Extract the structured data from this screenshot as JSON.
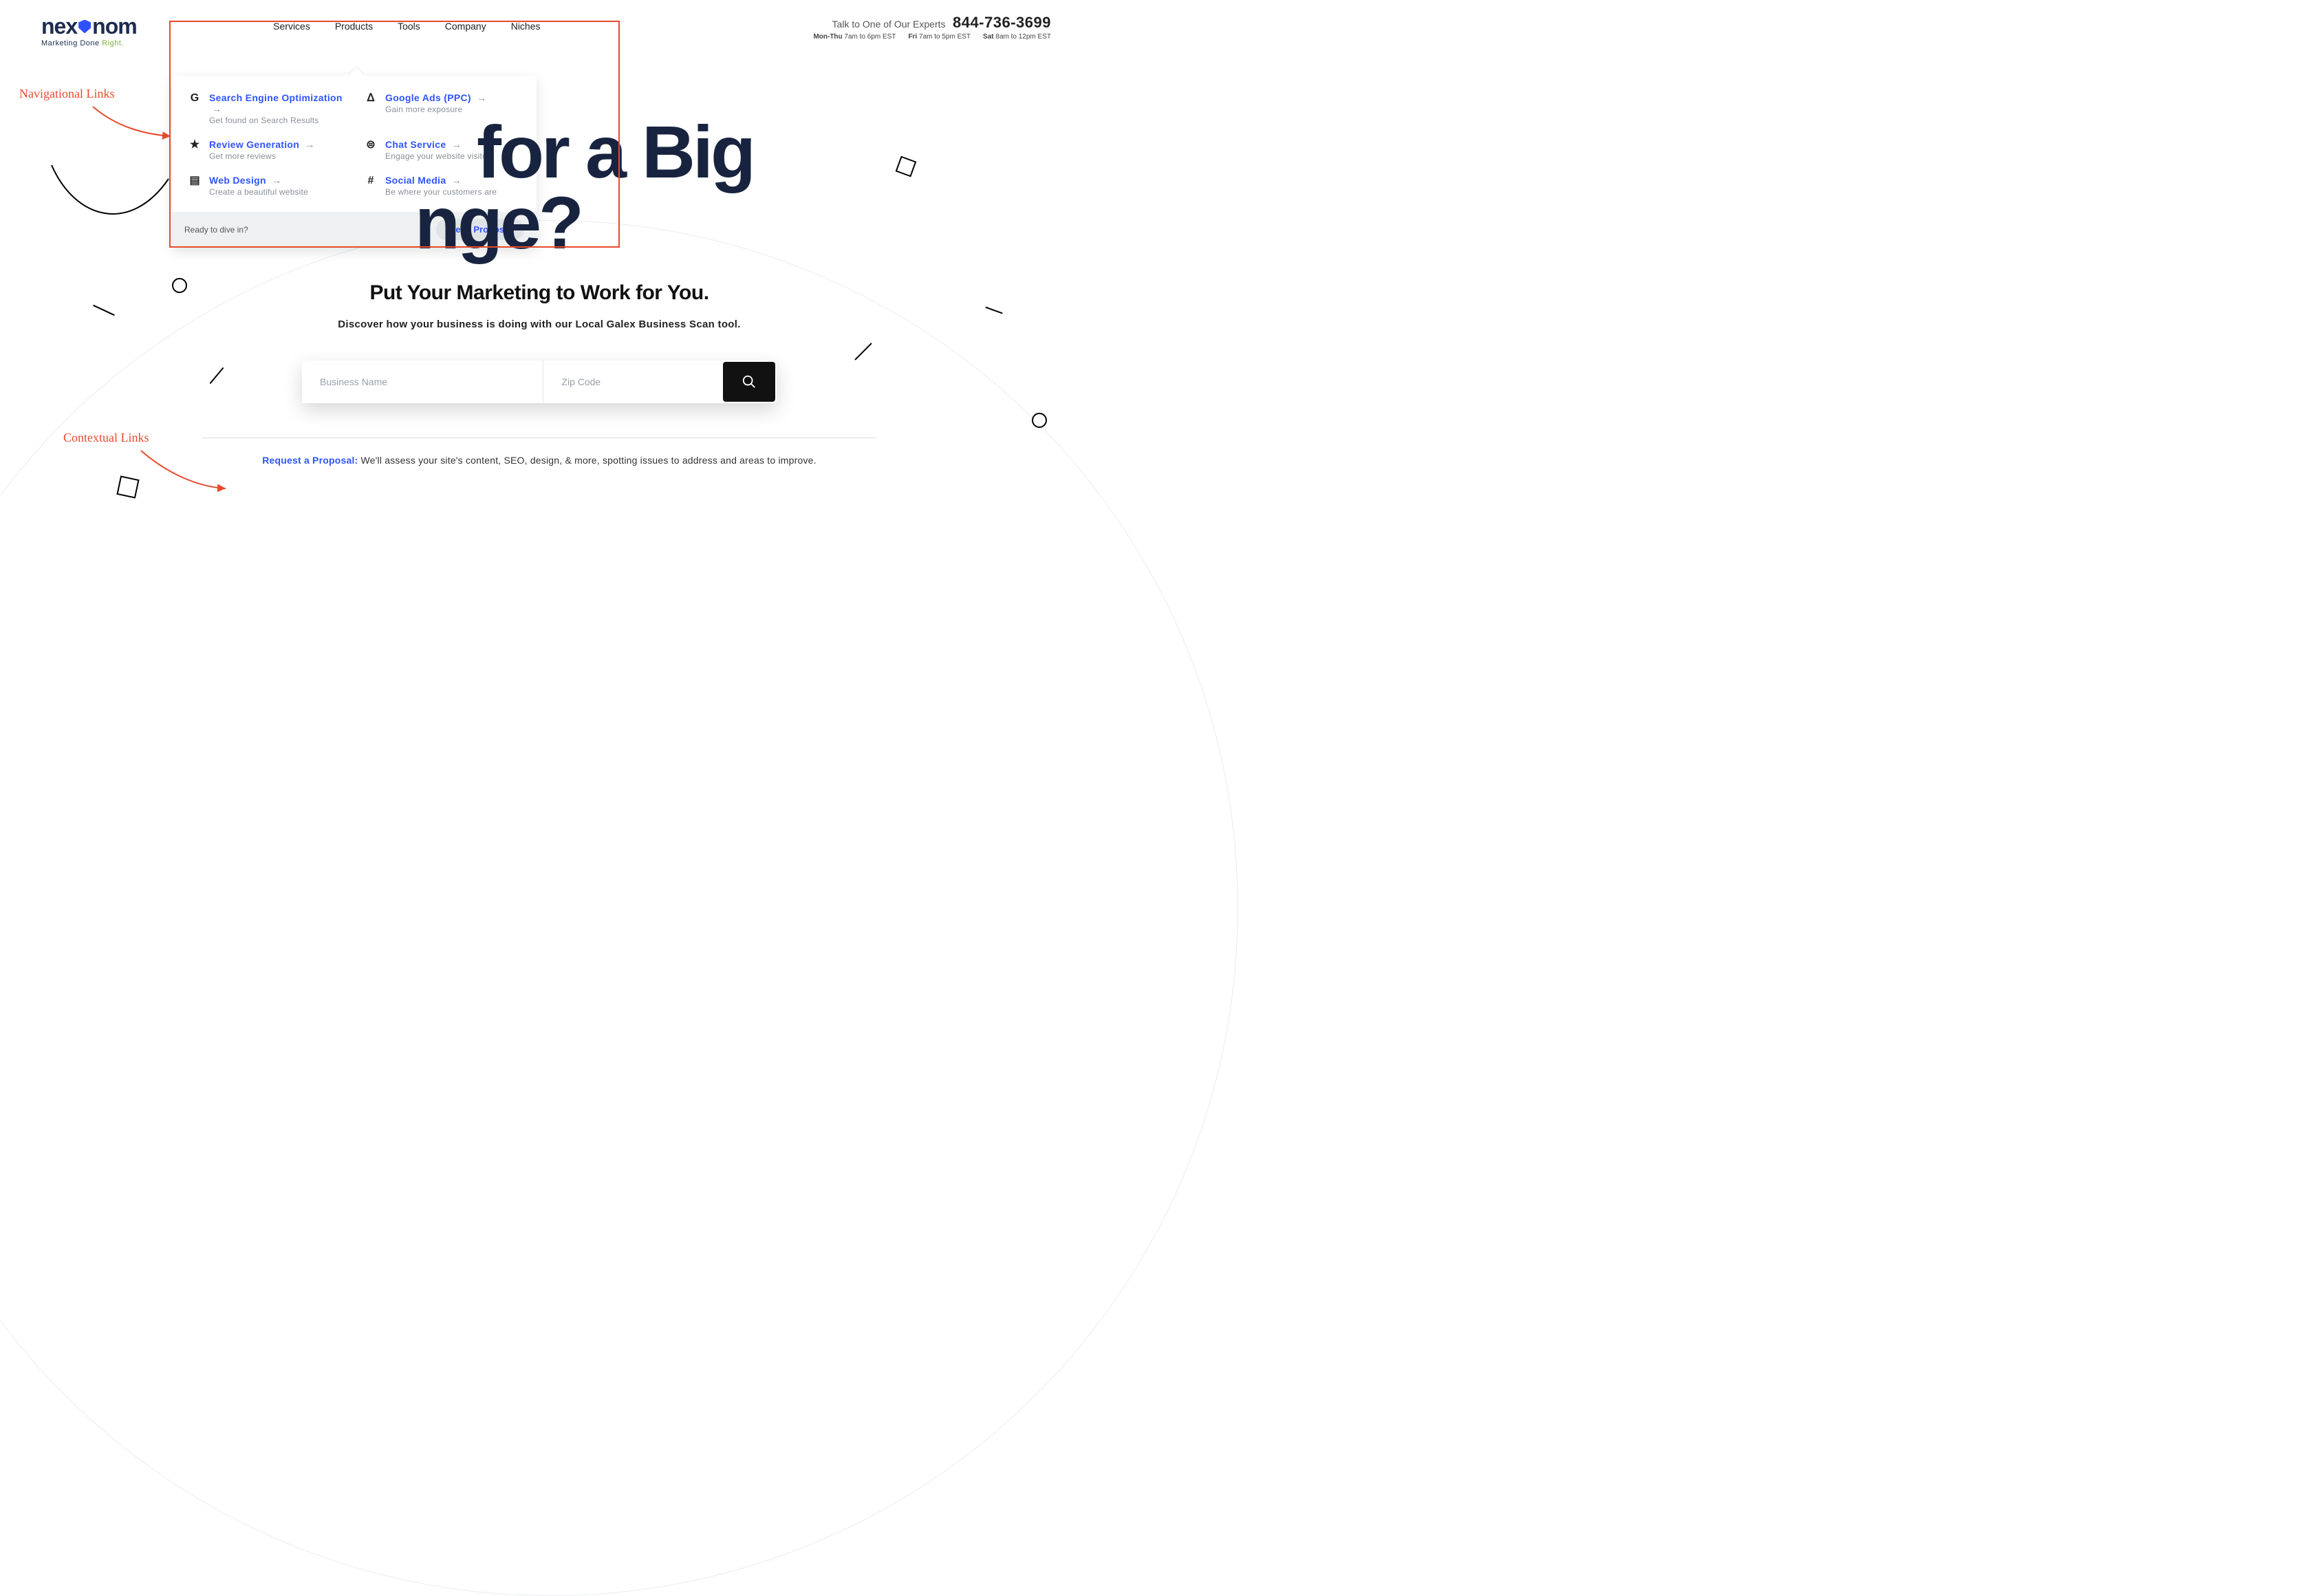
{
  "logo": {
    "word_left": "nex",
    "word_right": "nom",
    "tagline_prefix": "Marketing Done ",
    "tagline_highlight": "Right."
  },
  "nav": {
    "items": [
      "Services",
      "Products",
      "Tools",
      "Company",
      "Niches"
    ]
  },
  "contact": {
    "talk": "Talk to One of Our Experts",
    "phone": "844-736-3699",
    "hours": [
      {
        "day": "Mon-Thu",
        "time": "7am to 6pm EST"
      },
      {
        "day": "Fri",
        "time": "7am to 5pm EST"
      },
      {
        "day": "Sat",
        "time": "8am to 12pm EST"
      }
    ]
  },
  "dropdown": {
    "items": [
      {
        "icon": "google-icon",
        "glyph": "G",
        "title": "Search Engine Optimization",
        "sub": "Get found on Search Results"
      },
      {
        "icon": "ads-icon",
        "glyph": "ᐃ",
        "title": "Google Ads (PPC)",
        "sub": "Gain more exposure"
      },
      {
        "icon": "star-icon",
        "glyph": "★",
        "title": "Review Generation",
        "sub": "Get more reviews"
      },
      {
        "icon": "chat-icon",
        "glyph": "⊜",
        "title": "Chat Service",
        "sub": "Engage your website visitors"
      },
      {
        "icon": "layout-icon",
        "glyph": "▤",
        "title": "Web Design",
        "sub": "Create a beautiful website"
      },
      {
        "icon": "hash-icon",
        "glyph": "#",
        "title": "Social Media",
        "sub": "Be where your customers are"
      }
    ],
    "ready": "Ready to dive in?",
    "cta": "Get a Proposal"
  },
  "hero": {
    "line1": "for a Big",
    "line2": "nge?",
    "sub": "Put Your Marketing to Work for You.",
    "desc": "Discover how your business is doing with our Local Galex Business Scan tool."
  },
  "search": {
    "business_ph": "Business Name",
    "zip_ph": "Zip Code"
  },
  "proposal": {
    "link": "Request a Proposal:",
    "text": " We'll assess your site's content, SEO, design, & more, spotting issues to address and areas to improve."
  },
  "annotations": {
    "nav": "Navigational Links",
    "ctx": "Contextual Links"
  }
}
